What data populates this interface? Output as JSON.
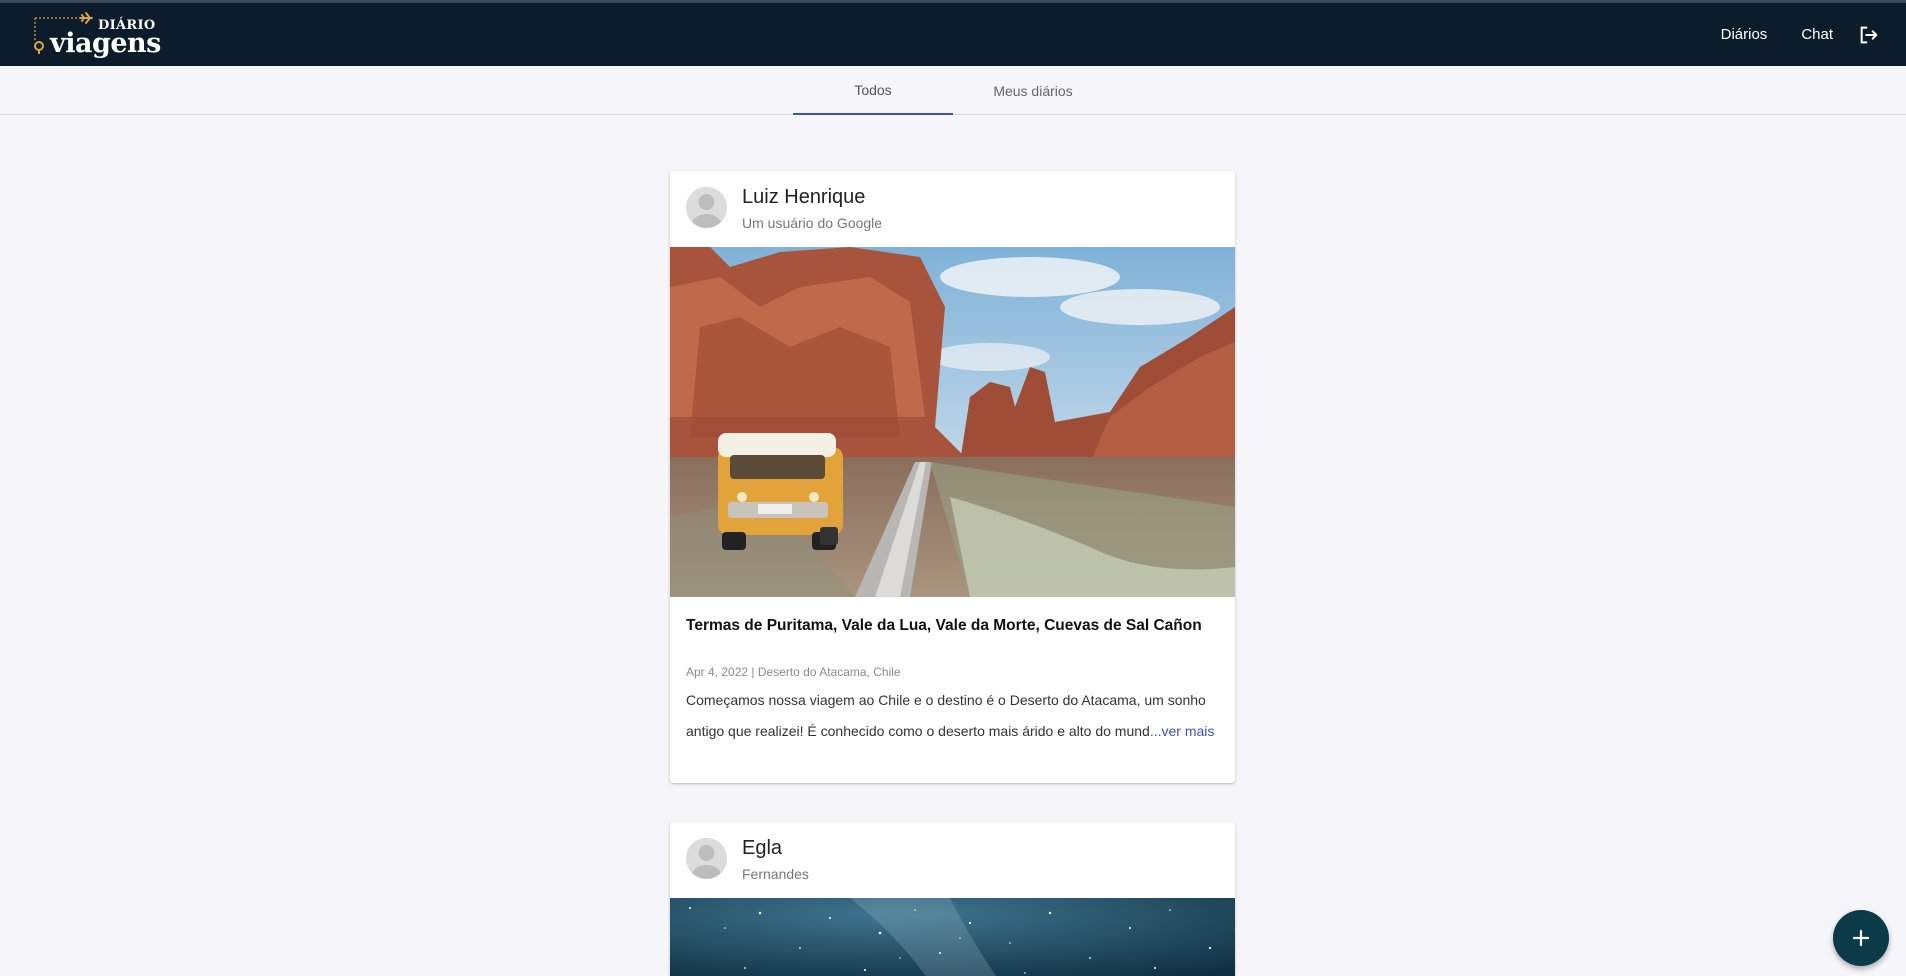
{
  "header": {
    "logo_small": "DIÁRIO",
    "logo_big": "viagens",
    "nav": [
      {
        "label": "Diários"
      },
      {
        "label": "Chat"
      }
    ],
    "logout_icon": "logout-icon"
  },
  "tabs": [
    {
      "label": "Todos",
      "active": true
    },
    {
      "label": "Meus diários",
      "active": false
    }
  ],
  "posts": [
    {
      "author": "Luiz Henrique",
      "subtitle": "Um usuário do Google",
      "title": "Termas de Puritama, Vale da Lua, Vale da Morte, Cuevas de Sal Cañon",
      "meta": "Apr 4, 2022 | Deserto do Atacama, Chile",
      "excerpt": "Começamos nossa viagem ao Chile e o destino é o Deserto do Atacama, um sonho antigo que realizei! É conhecido como o deserto mais árido e alto do mund",
      "more": "...ver mais"
    },
    {
      "author": "Egla",
      "subtitle": "Fernandes"
    }
  ],
  "fab": {
    "icon": "plus-icon"
  },
  "colors": {
    "header_bg": "#0c1c2a",
    "accent": "#3f51b5",
    "fab_bg": "#0b3a48",
    "page_bg": "#f6f6fa"
  }
}
